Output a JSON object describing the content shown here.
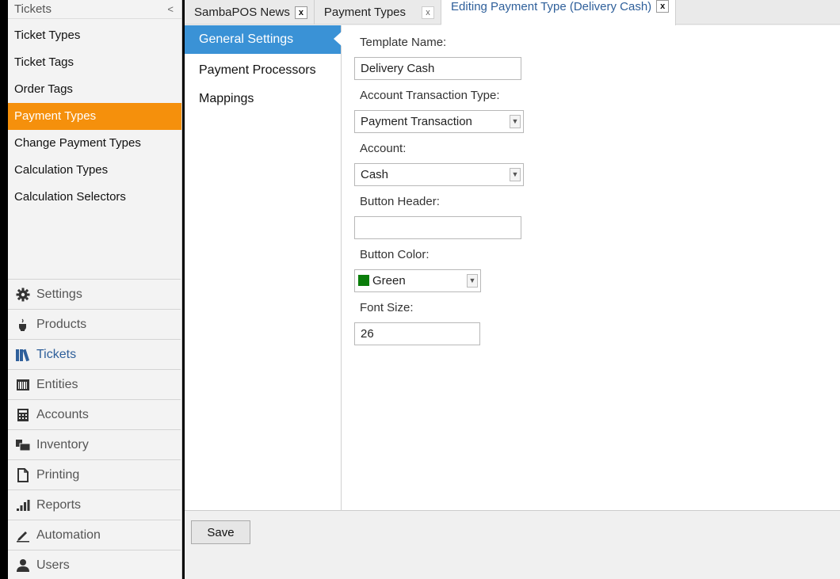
{
  "sidebar": {
    "header": "Tickets",
    "collapse_glyph": "<",
    "items": [
      {
        "label": "Ticket Types"
      },
      {
        "label": "Ticket Tags"
      },
      {
        "label": "Order Tags"
      },
      {
        "label": "Payment Types",
        "active": true
      },
      {
        "label": "Change Payment Types"
      },
      {
        "label": "Calculation Types"
      },
      {
        "label": "Calculation Selectors"
      }
    ],
    "nav": [
      {
        "label": "Settings",
        "icon": "gear-icon"
      },
      {
        "label": "Products",
        "icon": "coffee-cup-icon"
      },
      {
        "label": "Tickets",
        "icon": "books-icon",
        "active": true
      },
      {
        "label": "Entities",
        "icon": "barcode-icon"
      },
      {
        "label": "Accounts",
        "icon": "calculator-icon"
      },
      {
        "label": "Inventory",
        "icon": "boxes-icon"
      },
      {
        "label": "Printing",
        "icon": "document-icon"
      },
      {
        "label": "Reports",
        "icon": "bar-chart-icon"
      },
      {
        "label": "Automation",
        "icon": "pencil-icon"
      },
      {
        "label": "Users",
        "icon": "user-icon"
      }
    ]
  },
  "tabs": [
    {
      "label": "SambaPOS News"
    },
    {
      "label": "Payment Types"
    },
    {
      "label": "Editing Payment Type (Delivery Cash)",
      "active": true
    }
  ],
  "tab_close_glyph": "x",
  "subnav": [
    {
      "label": "General Settings",
      "active": true
    },
    {
      "label": "Payment Processors"
    },
    {
      "label": "Mappings"
    }
  ],
  "form": {
    "template_name_label": "Template Name:",
    "template_name_value": "Delivery Cash",
    "account_transaction_type_label": "Account Transaction Type:",
    "account_transaction_type_value": "Payment Transaction",
    "account_label": "Account:",
    "account_value": "Cash",
    "button_header_label": "Button Header:",
    "button_header_value": "",
    "button_color_label": "Button Color:",
    "button_color_value": "Green",
    "button_color_hex": "#0a7d0a",
    "font_size_label": "Font Size:",
    "font_size_value": "26"
  },
  "save_label": "Save",
  "colors": {
    "active_sidebar": "#f5900c",
    "active_subnav": "#3a92d6",
    "active_tab_text": "#2e5f9a"
  }
}
